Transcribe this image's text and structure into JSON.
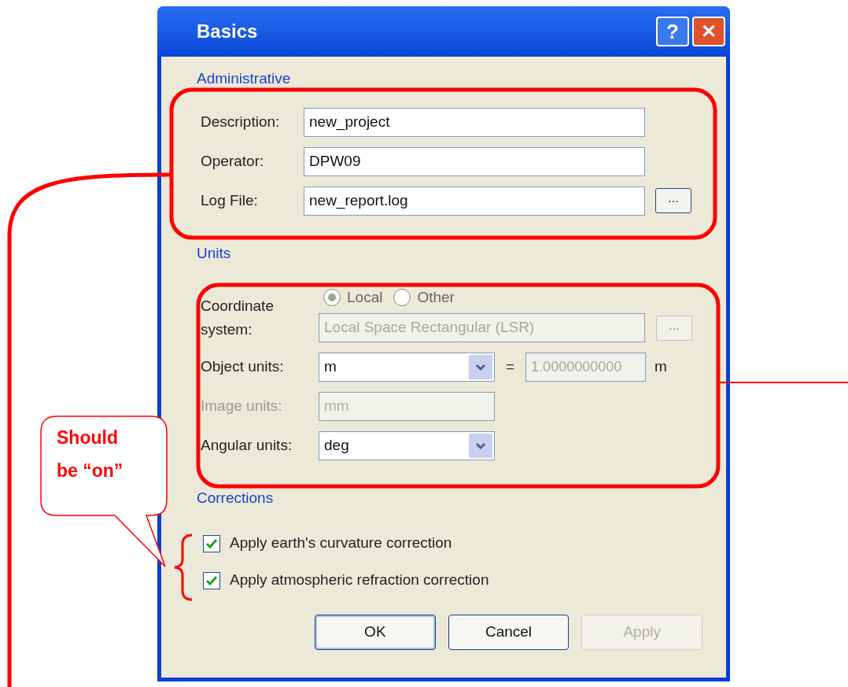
{
  "window": {
    "title": "Basics",
    "title_buttons": [
      "?",
      "✕"
    ]
  },
  "administrative": {
    "heading": "Administrative",
    "fields": [
      {
        "label": "Description:",
        "value": "new_project"
      },
      {
        "label": "Operator:",
        "value": "DPW09"
      },
      {
        "label": "Log File:",
        "value": "new_report.log",
        "browse": "..."
      }
    ]
  },
  "units": {
    "heading": "Units",
    "coordinate_label": "Coordinate system:",
    "radios": [
      {
        "label": "Local",
        "selected": true
      },
      {
        "label": "Other",
        "selected": false
      }
    ],
    "coordinate_value": "Local Space Rectangular (LSR)",
    "coordinate_browse": "...",
    "rows": [
      {
        "label": "Object units:",
        "value": "m",
        "disabled": false,
        "equals": "=",
        "factor": "1.0000000000",
        "factor_unit": "m"
      },
      {
        "label": "Image units:",
        "value": "mm",
        "disabled": true
      },
      {
        "label": "Angular units:",
        "value": "deg",
        "disabled": false
      }
    ]
  },
  "corrections": {
    "heading": "Corrections",
    "checks": [
      {
        "label": "Apply earth's curvature correction",
        "checked": true
      },
      {
        "label": "Apply atmospheric refraction correction",
        "checked": true
      }
    ]
  },
  "buttons": [
    {
      "label": "OK",
      "disabled": false,
      "default": true
    },
    {
      "label": "Cancel",
      "disabled": false,
      "default": false
    },
    {
      "label": "Apply",
      "disabled": true,
      "default": false
    }
  ],
  "annotation": {
    "callout": [
      "Should",
      "be “on”"
    ]
  }
}
